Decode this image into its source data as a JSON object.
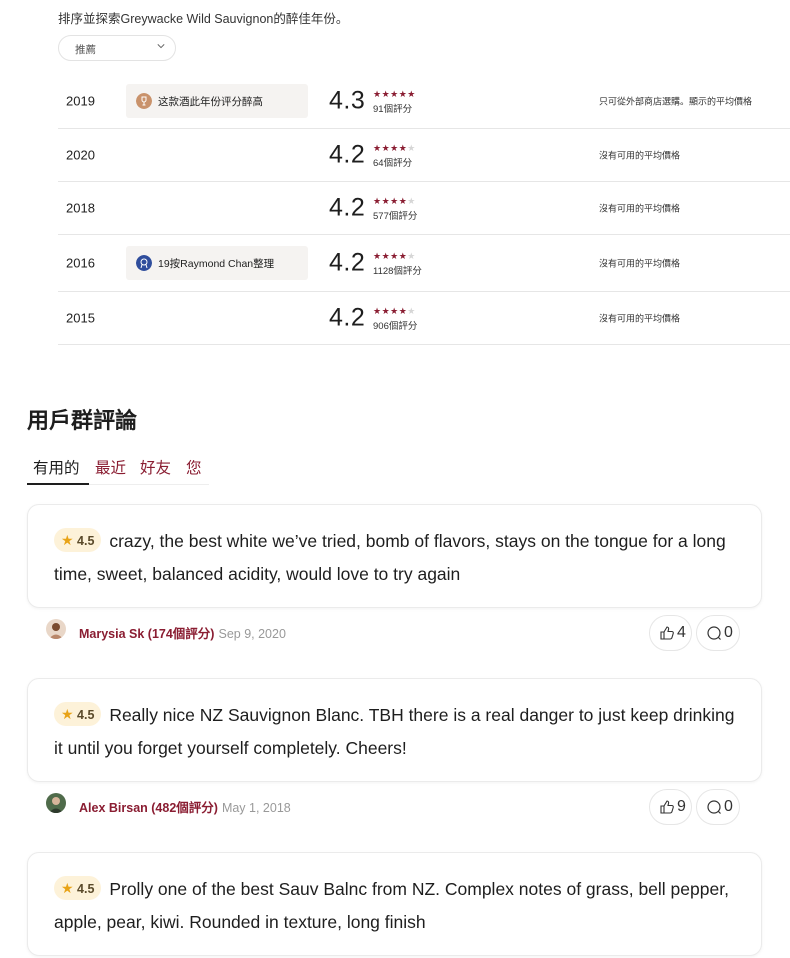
{
  "intro": "排序並探索Greywacke Wild Sauvignon的醉佳年份。",
  "sort": {
    "selected": "推薦"
  },
  "vintages": [
    {
      "year": "2019",
      "badge": "这款酒此年份评分醉高",
      "badge_icon": "wine-glass-icon",
      "score": "4.3",
      "stars": 4.3,
      "count": "91個評分",
      "price": "只可從外部商店選購。顯示的平均價格"
    },
    {
      "year": "2020",
      "badge": "",
      "score": "4.2",
      "stars": 4.2,
      "count": "64個評分",
      "price": "沒有可用的平均價格"
    },
    {
      "year": "2018",
      "badge": "",
      "score": "4.2",
      "stars": 4.2,
      "count": "577個評分",
      "price": "沒有可用的平均價格"
    },
    {
      "year": "2016",
      "badge": "19按Raymond Chan整理",
      "badge_icon": "ribbon-icon",
      "score": "4.2",
      "stars": 4.2,
      "count": "1128個評分",
      "price": "沒有可用的平均價格"
    },
    {
      "year": "2015",
      "badge": "",
      "score": "4.2",
      "stars": 4.2,
      "count": "906個評分",
      "price": "沒有可用的平均價格"
    }
  ],
  "reviews_section": {
    "title": "用戶群評論",
    "tabs": [
      "有用的",
      "最近",
      "好友",
      "您"
    ],
    "active_tab": "有用的"
  },
  "reviews": [
    {
      "rating": "4.5",
      "text": "crazy, the best white we’ve tried, bomb of flavors, stays on the tongue for a long time, sweet, balanced acidity, would love to try again",
      "author": "Marysia Sk (174個評分)",
      "date": "Sep 9, 2020",
      "likes": "4",
      "comments": "0"
    },
    {
      "rating": "4.5",
      "text": "Really nice NZ Sauvignon Blanc. TBH there is a real danger to just keep drinking it until you forget yourself completely. Cheers!",
      "author": "Alex Birsan (482個評分)",
      "date": "May 1, 2018",
      "likes": "9",
      "comments": "0"
    },
    {
      "rating": "4.5",
      "text": "Prolly one of the best Sauv Balnc from NZ. Complex notes of grass, bell pepper, apple, pear, kiwi. Rounded in texture, long finish",
      "author": "",
      "date": "",
      "likes": "",
      "comments": ""
    }
  ],
  "colors": {
    "accent": "#8a1d32",
    "badge_bg": "#fdf2d9",
    "star_gold": "#e8a317"
  }
}
